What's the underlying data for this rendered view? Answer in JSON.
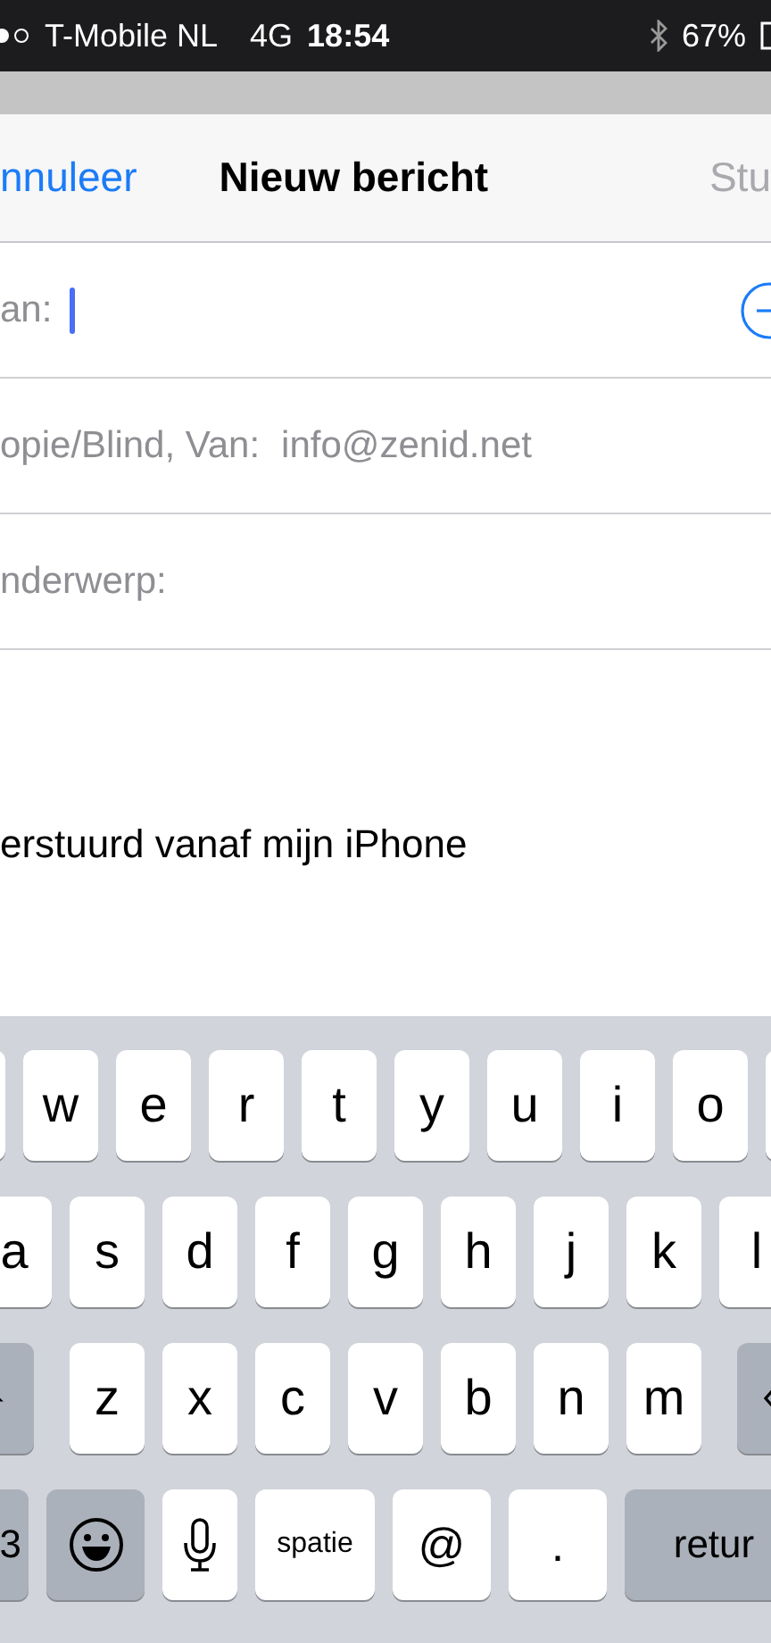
{
  "status_bar": {
    "carrier": "T-Mobile NL",
    "network": "4G",
    "time": "18:54",
    "battery": "67%"
  },
  "nav": {
    "cancel": "nnuleer",
    "title": "Nieuw bericht",
    "send": "Stu",
    "send_disabled": true
  },
  "fields": [
    {
      "kind": "recipient",
      "label": "an:",
      "focused": true
    },
    {
      "kind": "plain",
      "label": "opie/Blind, Van:",
      "value": "info@zenid.net",
      "focused": false
    },
    {
      "kind": "plain",
      "label": "nderwerp:",
      "focused": false
    }
  ],
  "body": "erstuurd vanaf mijn iPhone",
  "keyboard": [
    {
      "keys": [
        {
          "kind": "blank"
        },
        {
          "kind": "letter",
          "label": "w"
        },
        {
          "kind": "letter",
          "label": "e"
        },
        {
          "kind": "letter",
          "label": "r"
        },
        {
          "kind": "letter",
          "label": "t"
        },
        {
          "kind": "letter",
          "label": "y"
        },
        {
          "kind": "letter",
          "label": "u"
        },
        {
          "kind": "letter",
          "label": "i"
        },
        {
          "kind": "letter",
          "label": "o"
        },
        {
          "kind": "blank"
        }
      ]
    },
    {
      "keys": [
        {
          "kind": "letter",
          "label": "a"
        },
        {
          "kind": "letter",
          "label": "s"
        },
        {
          "kind": "letter",
          "label": "d"
        },
        {
          "kind": "letter",
          "label": "f"
        },
        {
          "kind": "letter",
          "label": "g"
        },
        {
          "kind": "letter",
          "label": "h"
        },
        {
          "kind": "letter",
          "label": "j"
        },
        {
          "kind": "letter",
          "label": "k"
        },
        {
          "kind": "letter",
          "label": "l"
        }
      ]
    },
    {
      "keys": [
        {
          "kind": "shift"
        },
        {
          "kind": "letter",
          "label": "z"
        },
        {
          "kind": "letter",
          "label": "x"
        },
        {
          "kind": "letter",
          "label": "c"
        },
        {
          "kind": "letter",
          "label": "v"
        },
        {
          "kind": "letter",
          "label": "b"
        },
        {
          "kind": "letter",
          "label": "n"
        },
        {
          "kind": "letter",
          "label": "m"
        },
        {
          "kind": "backspace"
        }
      ]
    },
    {
      "keys": [
        {
          "kind": "mode",
          "label": "3"
        },
        {
          "kind": "emoji"
        },
        {
          "kind": "mic"
        },
        {
          "kind": "space",
          "label": "spatie"
        },
        {
          "kind": "symbol",
          "label": "@"
        },
        {
          "kind": "symbol",
          "label": "."
        },
        {
          "kind": "return",
          "label": "retur"
        }
      ]
    }
  ]
}
